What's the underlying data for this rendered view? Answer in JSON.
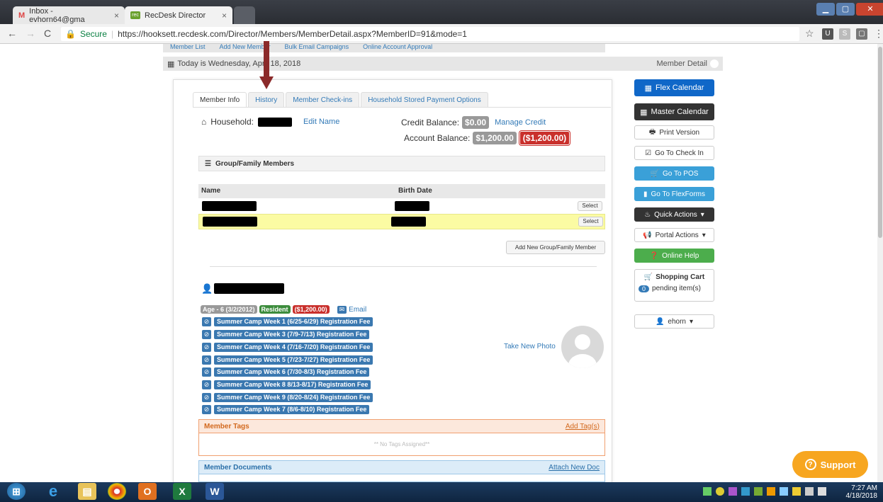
{
  "browser": {
    "tabs": [
      {
        "label": "Inbox - evhorn64@gma"
      },
      {
        "label": "RecDesk Director"
      }
    ],
    "secure_label": "Secure",
    "url": "https://hooksett.recdesk.com/Director/Members/MemberDetail.aspx?MemberID=91&mode=1"
  },
  "subnav": [
    "Member List",
    "Add New Member",
    "Bulk Email Campaigns",
    "Online Account Approval"
  ],
  "datebar": {
    "today": "Today is Wednesday, April 18, 2018",
    "right": "Member Detail"
  },
  "tabs": [
    "Member Info",
    "History",
    "Member Check-ins",
    "Household Stored Payment Options"
  ],
  "household": {
    "label": "Household:",
    "edit": "Edit Name",
    "credit_label": "Credit Balance:",
    "credit_value": "$0.00",
    "manage_credit": "Manage Credit",
    "account_label": "Account Balance:",
    "account_value": "$1,200.00",
    "account_due": "($1,200.00)"
  },
  "group": {
    "title": "Group/Family Members",
    "col_name": "Name",
    "col_birth": "Birth Date",
    "select": "Select",
    "add": "Add New Group/Family Member"
  },
  "member": {
    "age": "Age - 6 (3/2/2012)",
    "resident": "Resident",
    "balance": "($1,200.00)",
    "email": "Email",
    "take_photo": "Take New Photo",
    "registrations": [
      "Summer Camp Week 1 (6/25-6/29) Registration Fee",
      "Summer Camp Week 3 (7/9-7/13) Registration Fee",
      "Summer Camp Week 4 (7/16-7/20) Registration Fee",
      "Summer Camp Week 5 (7/23-7/27) Registration Fee",
      "Summer Camp Week 6 (7/30-8/3) Registration Fee",
      "Summer Camp Week 8 8/13-8/17) Registration Fee",
      "Summer Camp Week 9 (8/20-8/24) Registration Fee",
      "Summer Camp Week 7 (8/6-8/10) Registration Fee"
    ]
  },
  "tags": {
    "title": "Member Tags",
    "add": "Add Tag(s)",
    "empty": "** No Tags Assigned**"
  },
  "docs": {
    "title": "Member Documents",
    "attach": "Attach New Doc"
  },
  "actions": {
    "flex_calendar": "Flex Calendar",
    "master_calendar": "Master Calendar",
    "print": "Print Version",
    "checkin": "Go To Check In",
    "pos": "Go To POS",
    "flexforms": "Go To FlexForms",
    "quick": "Quick Actions",
    "portal": "Portal Actions",
    "help": "Online Help",
    "cart_title": "Shopping Cart",
    "cart_count": "0",
    "cart_text": "pending item(s)",
    "user": "ehorn"
  },
  "support": "Support",
  "taskbar": {
    "time": "7:27 AM",
    "date": "4/18/2018"
  }
}
